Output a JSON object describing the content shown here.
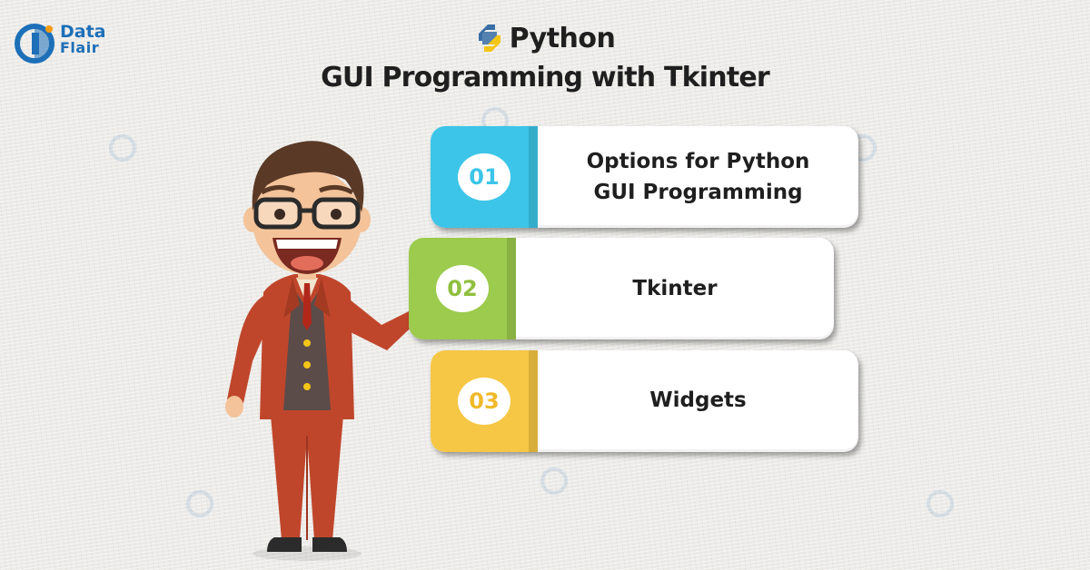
{
  "brand": {
    "logo_line1": "Data",
    "logo_line2": "Flair",
    "colors": {
      "brand_blue": "#1d6fb8",
      "python_blue": "#3a6ea5",
      "python_yellow": "#f5c518"
    }
  },
  "header": {
    "title": "Python",
    "subtitle": "GUI Programming with Tkinter",
    "python_logo_icon": "python-logo-icon"
  },
  "items": [
    {
      "number": "01",
      "label": "Options for Python\nGUI Programming",
      "color": "#3cc5e8",
      "num_color": "#3cc5e8"
    },
    {
      "number": "02",
      "label": "Tkinter",
      "color": "#9ccb4d",
      "num_color": "#8fbf3e"
    },
    {
      "number": "03",
      "label": "Widgets",
      "color": "#f6c744",
      "num_color": "#f0b92a"
    }
  ],
  "character": {
    "icon": "presenter-character-illustration"
  }
}
